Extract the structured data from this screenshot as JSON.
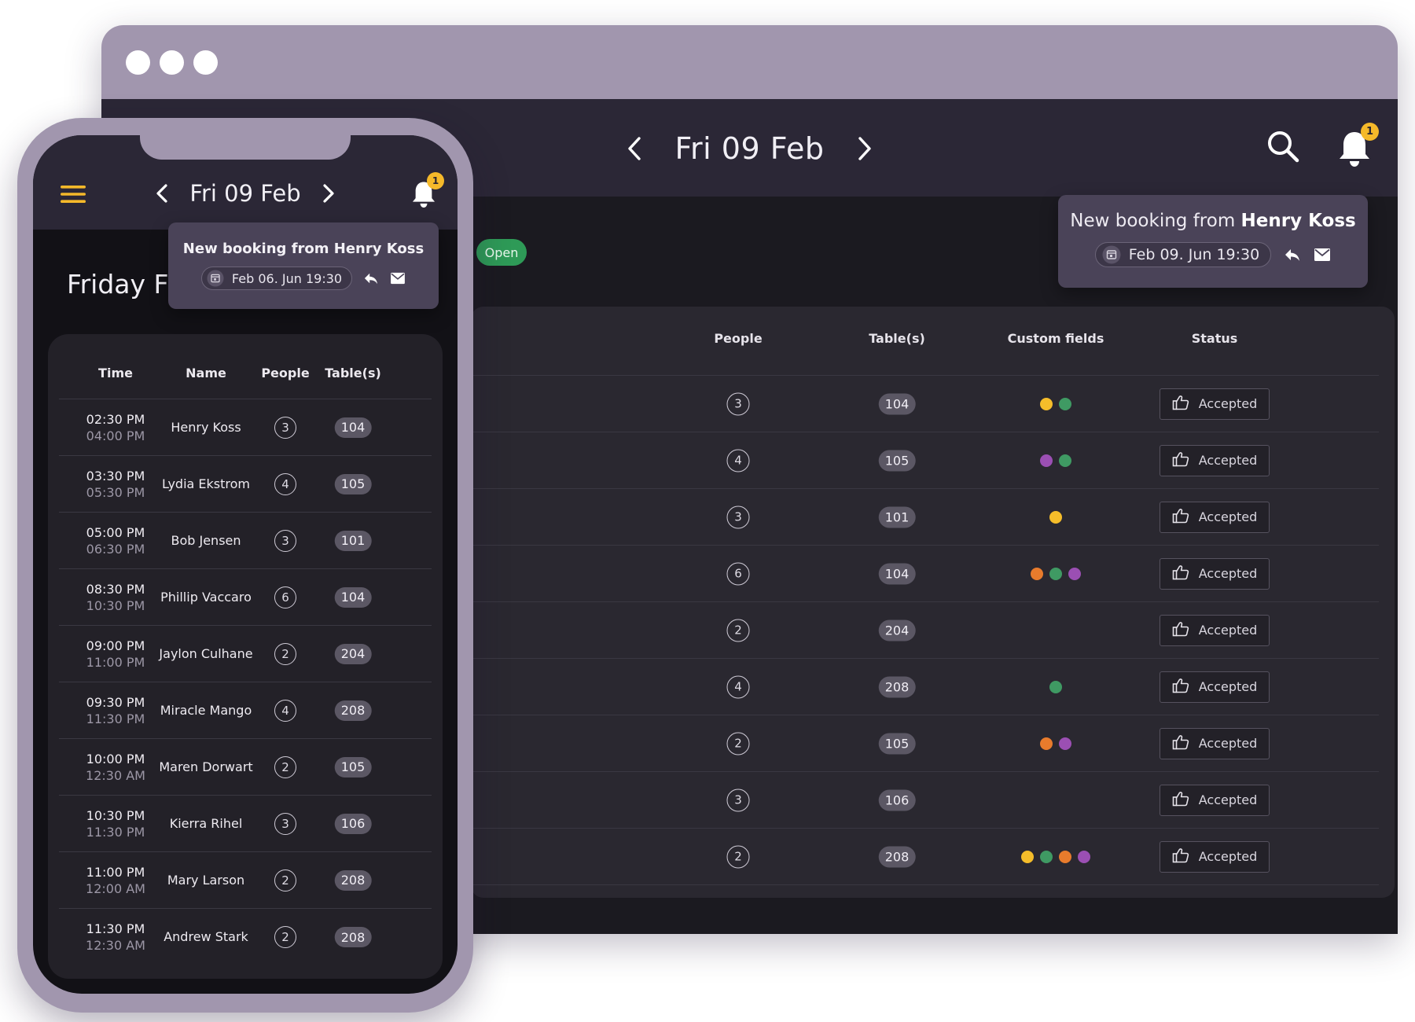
{
  "desktop": {
    "header": {
      "date": "Fri 09 Feb"
    },
    "notification": {
      "prefix": "New booking from ",
      "name": "Henry Koss",
      "date": "Feb 09. Jun 19:30",
      "badge_count": "1"
    },
    "status_chip": "Open",
    "table": {
      "columns": {
        "people": "People",
        "tables": "Table(s)",
        "custom_fields": "Custom fields",
        "status": "Status"
      },
      "rows": [
        {
          "people": "3",
          "table": "104",
          "status": "Accepted",
          "dots": [
            "#f5bd2a",
            "#3f9a63"
          ]
        },
        {
          "people": "4",
          "table": "105",
          "status": "Accepted",
          "dots": [
            "#9b4fb3",
            "#3f9a63"
          ]
        },
        {
          "people": "3",
          "table": "101",
          "status": "Accepted",
          "dots": [
            "#f5bd2a"
          ]
        },
        {
          "people": "6",
          "table": "104",
          "status": "Accepted",
          "dots": [
            "#e87b2c",
            "#3f9a63",
            "#9b4fb3"
          ]
        },
        {
          "people": "2",
          "table": "204",
          "status": "Accepted",
          "dots": []
        },
        {
          "people": "4",
          "table": "208",
          "status": "Accepted",
          "dots": [
            "#3f9a63"
          ]
        },
        {
          "people": "2",
          "table": "105",
          "status": "Accepted",
          "dots": [
            "#e87b2c",
            "#9b4fb3"
          ]
        },
        {
          "people": "3",
          "table": "106",
          "status": "Accepted",
          "dots": []
        },
        {
          "people": "2",
          "table": "208",
          "status": "Accepted",
          "dots": [
            "#f5bd2a",
            "#3f9a63",
            "#e87b2c",
            "#9b4fb3"
          ]
        }
      ]
    }
  },
  "mobile": {
    "header": {
      "date": "Fri 09 Feb"
    },
    "title": "Friday Fe",
    "notification": {
      "title": "New booking from Henry Koss",
      "date": "Feb 06. Jun 19:30",
      "badge_count": "1"
    },
    "table": {
      "columns": {
        "time": "Time",
        "name": "Name",
        "people": "People",
        "tables": "Table(s)"
      },
      "rows": [
        {
          "start": "02:30 PM",
          "end": "04:00 PM",
          "name": "Henry Koss",
          "people": "3",
          "table": "104"
        },
        {
          "start": "03:30 PM",
          "end": "05:30 PM",
          "name": "Lydia Ekstrom",
          "people": "4",
          "table": "105"
        },
        {
          "start": "05:00 PM",
          "end": "06:30 PM",
          "name": "Bob Jensen",
          "people": "3",
          "table": "101"
        },
        {
          "start": "08:30 PM",
          "end": "10:30 PM",
          "name": "Phillip Vaccaro",
          "people": "6",
          "table": "104"
        },
        {
          "start": "09:00 PM",
          "end": "11:00 PM",
          "name": "Jaylon Culhane",
          "people": "2",
          "table": "204"
        },
        {
          "start": "09:30 PM",
          "end": "11:30 PM",
          "name": "Miracle Mango",
          "people": "4",
          "table": "208"
        },
        {
          "start": "10:00 PM",
          "end": "12:30 AM",
          "name": "Maren Dorwart",
          "people": "2",
          "table": "105"
        },
        {
          "start": "10:30 PM",
          "end": "11:30 PM",
          "name": "Kierra Rihel",
          "people": "3",
          "table": "106"
        },
        {
          "start": "11:00 PM",
          "end": "12:00 AM",
          "name": "Mary Larson",
          "people": "2",
          "table": "208"
        },
        {
          "start": "11:30 PM",
          "end": "12:30 AM",
          "name": "Andrew Stark",
          "people": "2",
          "table": "208"
        }
      ]
    }
  },
  "icons": {
    "menu": "hamburger-menu-icon",
    "prev": "chevron-left-icon",
    "next": "chevron-right-icon",
    "search": "search-icon",
    "bell": "bell-icon",
    "calendar": "calendar-icon",
    "reply": "reply-icon",
    "mail": "mail-icon",
    "thumbs_up": "thumbs-up-icon"
  },
  "colors": {
    "chrome": "#a196ae",
    "header": "#2b2736",
    "background": "#1b1a20",
    "accent_yellow": "#f5b92a",
    "open_green": "#2e9a57"
  }
}
